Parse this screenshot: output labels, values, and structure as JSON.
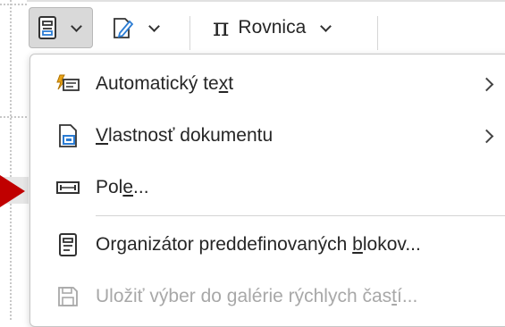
{
  "toolbar": {
    "quick_parts_icon": "quick-parts-icon",
    "signature_icon": "signature-line-icon",
    "equation_symbol": "π",
    "equation_label": "Rovnica"
  },
  "menu": {
    "items": [
      {
        "label_pre": "Automatický te",
        "label_ul": "x",
        "label_post": "t",
        "icon": "autotext-icon",
        "has_submenu": true,
        "enabled": true
      },
      {
        "label_pre": "",
        "label_ul": "V",
        "label_post": "lastnosť dokumentu",
        "icon": "document-property-icon",
        "has_submenu": true,
        "enabled": true
      },
      {
        "label_pre": "Pol",
        "label_ul": "e",
        "label_post": "...",
        "icon": "field-icon",
        "has_submenu": false,
        "enabled": true
      },
      {
        "label_pre": "Organizátor preddefinovaných ",
        "label_ul": "b",
        "label_post": "lokov...",
        "icon": "building-blocks-organizer-icon",
        "has_submenu": false,
        "enabled": true
      },
      {
        "label_pre": "Uložiť výber do galérie rýchlych čas",
        "label_ul": "t",
        "label_post": "í...",
        "icon": "save-icon",
        "has_submenu": false,
        "enabled": false
      }
    ]
  },
  "colors": {
    "accent_blue": "#2b7cd3",
    "accent_orange": "#e8a317",
    "pointer_red": "#c00000",
    "disabled_text": "#a8a8a8"
  }
}
